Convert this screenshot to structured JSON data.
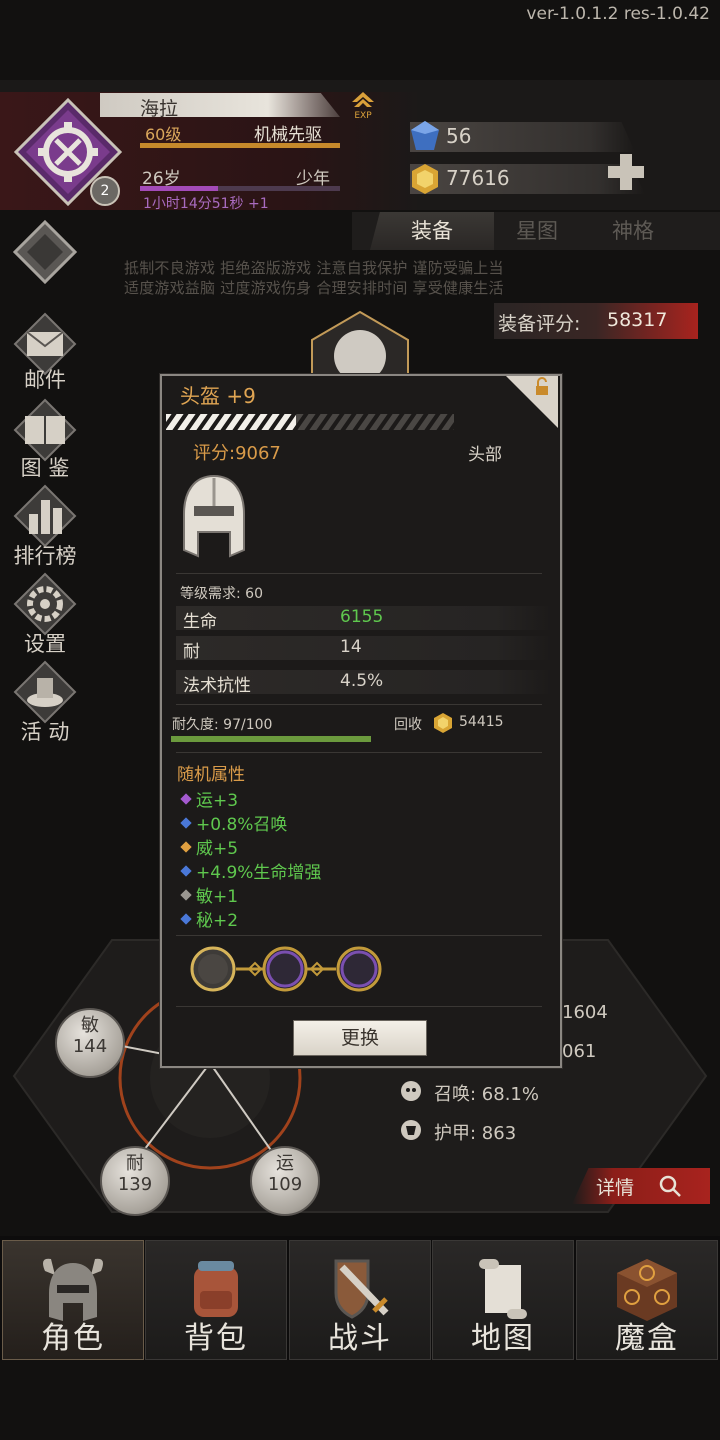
{
  "version": "ver-1.0.1.2  res-1.0.42",
  "profile": {
    "name": "海拉",
    "level_badge": "2",
    "level": "60级",
    "class": "机械先驱",
    "age": "26岁",
    "stage": "少年",
    "timer": "1小时14分51秒 +1",
    "exp_icon": "exp-arrow-icon"
  },
  "currency": {
    "gems": "56",
    "gold": "77616"
  },
  "tabs": [
    "装备",
    "星图",
    "神格"
  ],
  "notice": {
    "line1": "抵制不良游戏 拒绝盗版游戏 注意自我保护 谨防受骗上当",
    "line2": "适度游戏益脑 过度游戏伤身 合理安排时间 享受健康生活"
  },
  "equip_score": {
    "label": "装备评分:",
    "value": "58317"
  },
  "side_menu": [
    {
      "label": "",
      "icon": "diamond-icon"
    },
    {
      "label": "邮件",
      "icon": "mail-icon"
    },
    {
      "label": "图 鉴",
      "icon": "book-icon"
    },
    {
      "label": "排行榜",
      "icon": "ranking-icon"
    },
    {
      "label": "设置",
      "icon": "gear-icon"
    },
    {
      "label": "活 动",
      "icon": "event-icon"
    }
  ],
  "stats": {
    "agi": {
      "name": "敏",
      "value": "144"
    },
    "con": {
      "name": "耐",
      "value": "139"
    },
    "luck": {
      "name": "运",
      "value": "109"
    },
    "right_partial_1": "1604",
    "right_partial_2": "061",
    "summon": "召唤: 68.1%",
    "armor": "护甲: 863",
    "details": "详情"
  },
  "popup": {
    "title": "头盔 +9",
    "score": "评分:9067",
    "slot": "头部",
    "requirement": "等级需求: 60",
    "attributes": [
      {
        "name": "生命",
        "value": "6155",
        "color": "#5fc84e"
      },
      {
        "name": "耐",
        "value": "14",
        "color": "#d9d3c9"
      },
      {
        "name": "法术抗性",
        "value": "4.5%",
        "color": "#d9d3c9"
      }
    ],
    "durability": "耐久度: 97/100",
    "recycle_label": "回收",
    "recycle_value": "54415",
    "random_title": "随机属性",
    "random_attrs": [
      {
        "text": "运+3",
        "dot": "#a45ad0"
      },
      {
        "text": "+0.8%召唤",
        "dot": "#4a78d8"
      },
      {
        "text": "威+5",
        "dot": "#e0a040"
      },
      {
        "text": "+4.9%生命增强",
        "dot": "#4a78d8"
      },
      {
        "text": "敏+1",
        "dot": "#9a9690"
      },
      {
        "text": "秘+2",
        "dot": "#4a78d8"
      }
    ],
    "replace_button": "更换"
  },
  "bottom_nav": [
    {
      "label": "角色",
      "icon": "helmet-icon"
    },
    {
      "label": "背包",
      "icon": "backpack-icon"
    },
    {
      "label": "战斗",
      "icon": "sword-shield-icon"
    },
    {
      "label": "地图",
      "icon": "scroll-map-icon"
    },
    {
      "label": "魔盒",
      "icon": "magic-box-icon"
    }
  ]
}
